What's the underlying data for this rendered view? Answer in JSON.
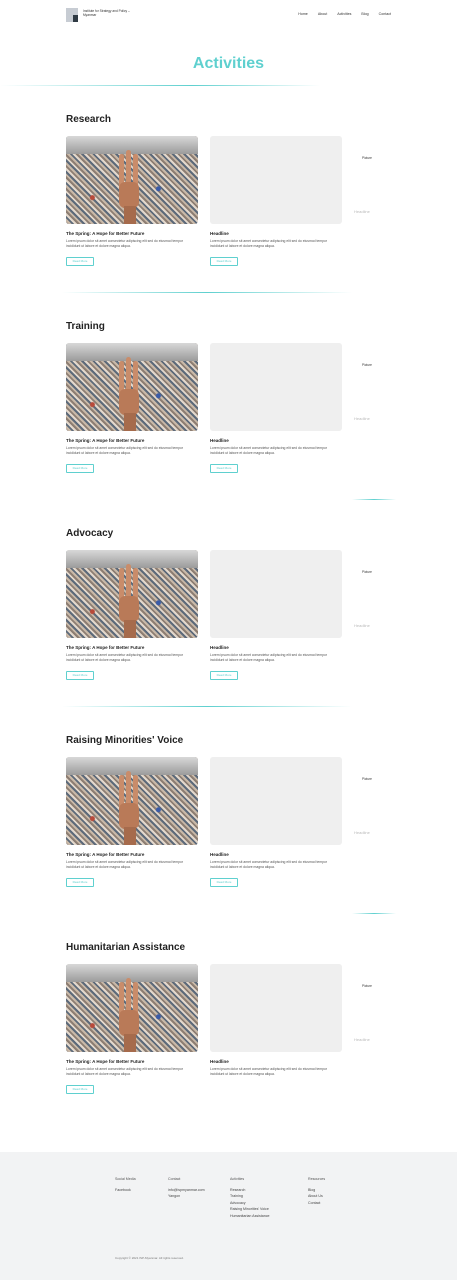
{
  "header": {
    "logo_text": "Institute for Strategy and Policy – Myanmar",
    "nav": [
      "Home",
      "About",
      "Activities",
      "Blog",
      "Contact"
    ]
  },
  "page_title": "Activities",
  "sections": [
    {
      "title": "Research"
    },
    {
      "title": "Training"
    },
    {
      "title": "Advocacy"
    },
    {
      "title": "Raising Minorities' Voice"
    },
    {
      "title": "Humanitarian Assistance"
    }
  ],
  "card_photo": {
    "headline": "The Spring: A Hope for Better Future",
    "text": "Lorem ipsum dolor sit amet consectetur adipiscing elit sed do eiusmod tempor incididunt ut labore et dolore magna aliqua.",
    "button": "Read More"
  },
  "card_placeholder": {
    "headline": "Headline",
    "text": "Lorem ipsum dolor sit amet consectetur adipiscing elit sed do eiusmod tempor incididunt ut labore et dolore magna aliqua.",
    "button": "Read More"
  },
  "faded_card": {
    "label": "Picture",
    "headline": "Headline"
  },
  "footer": {
    "col1": {
      "heading": "Social Media",
      "items": [
        "Facebook"
      ]
    },
    "col2": {
      "heading": "Contact",
      "items": [
        "info@ispmyanmar.com",
        "Yangon"
      ]
    },
    "col3": {
      "heading": "Activities",
      "items": [
        "Research",
        "Training",
        "Advocacy",
        "Raising Minorities' Voice",
        "Humanitarian Assistance"
      ]
    },
    "col4": {
      "heading": "Resources",
      "items": [
        "Blog",
        "About Us",
        "Contact"
      ]
    },
    "copyright": "Copyright © 2021 ISP-Myanmar. All rights reserved."
  },
  "colors": {
    "accent": "#5fd0cf",
    "placeholder": "#efefef",
    "footer_bg": "#f2f3f4"
  }
}
